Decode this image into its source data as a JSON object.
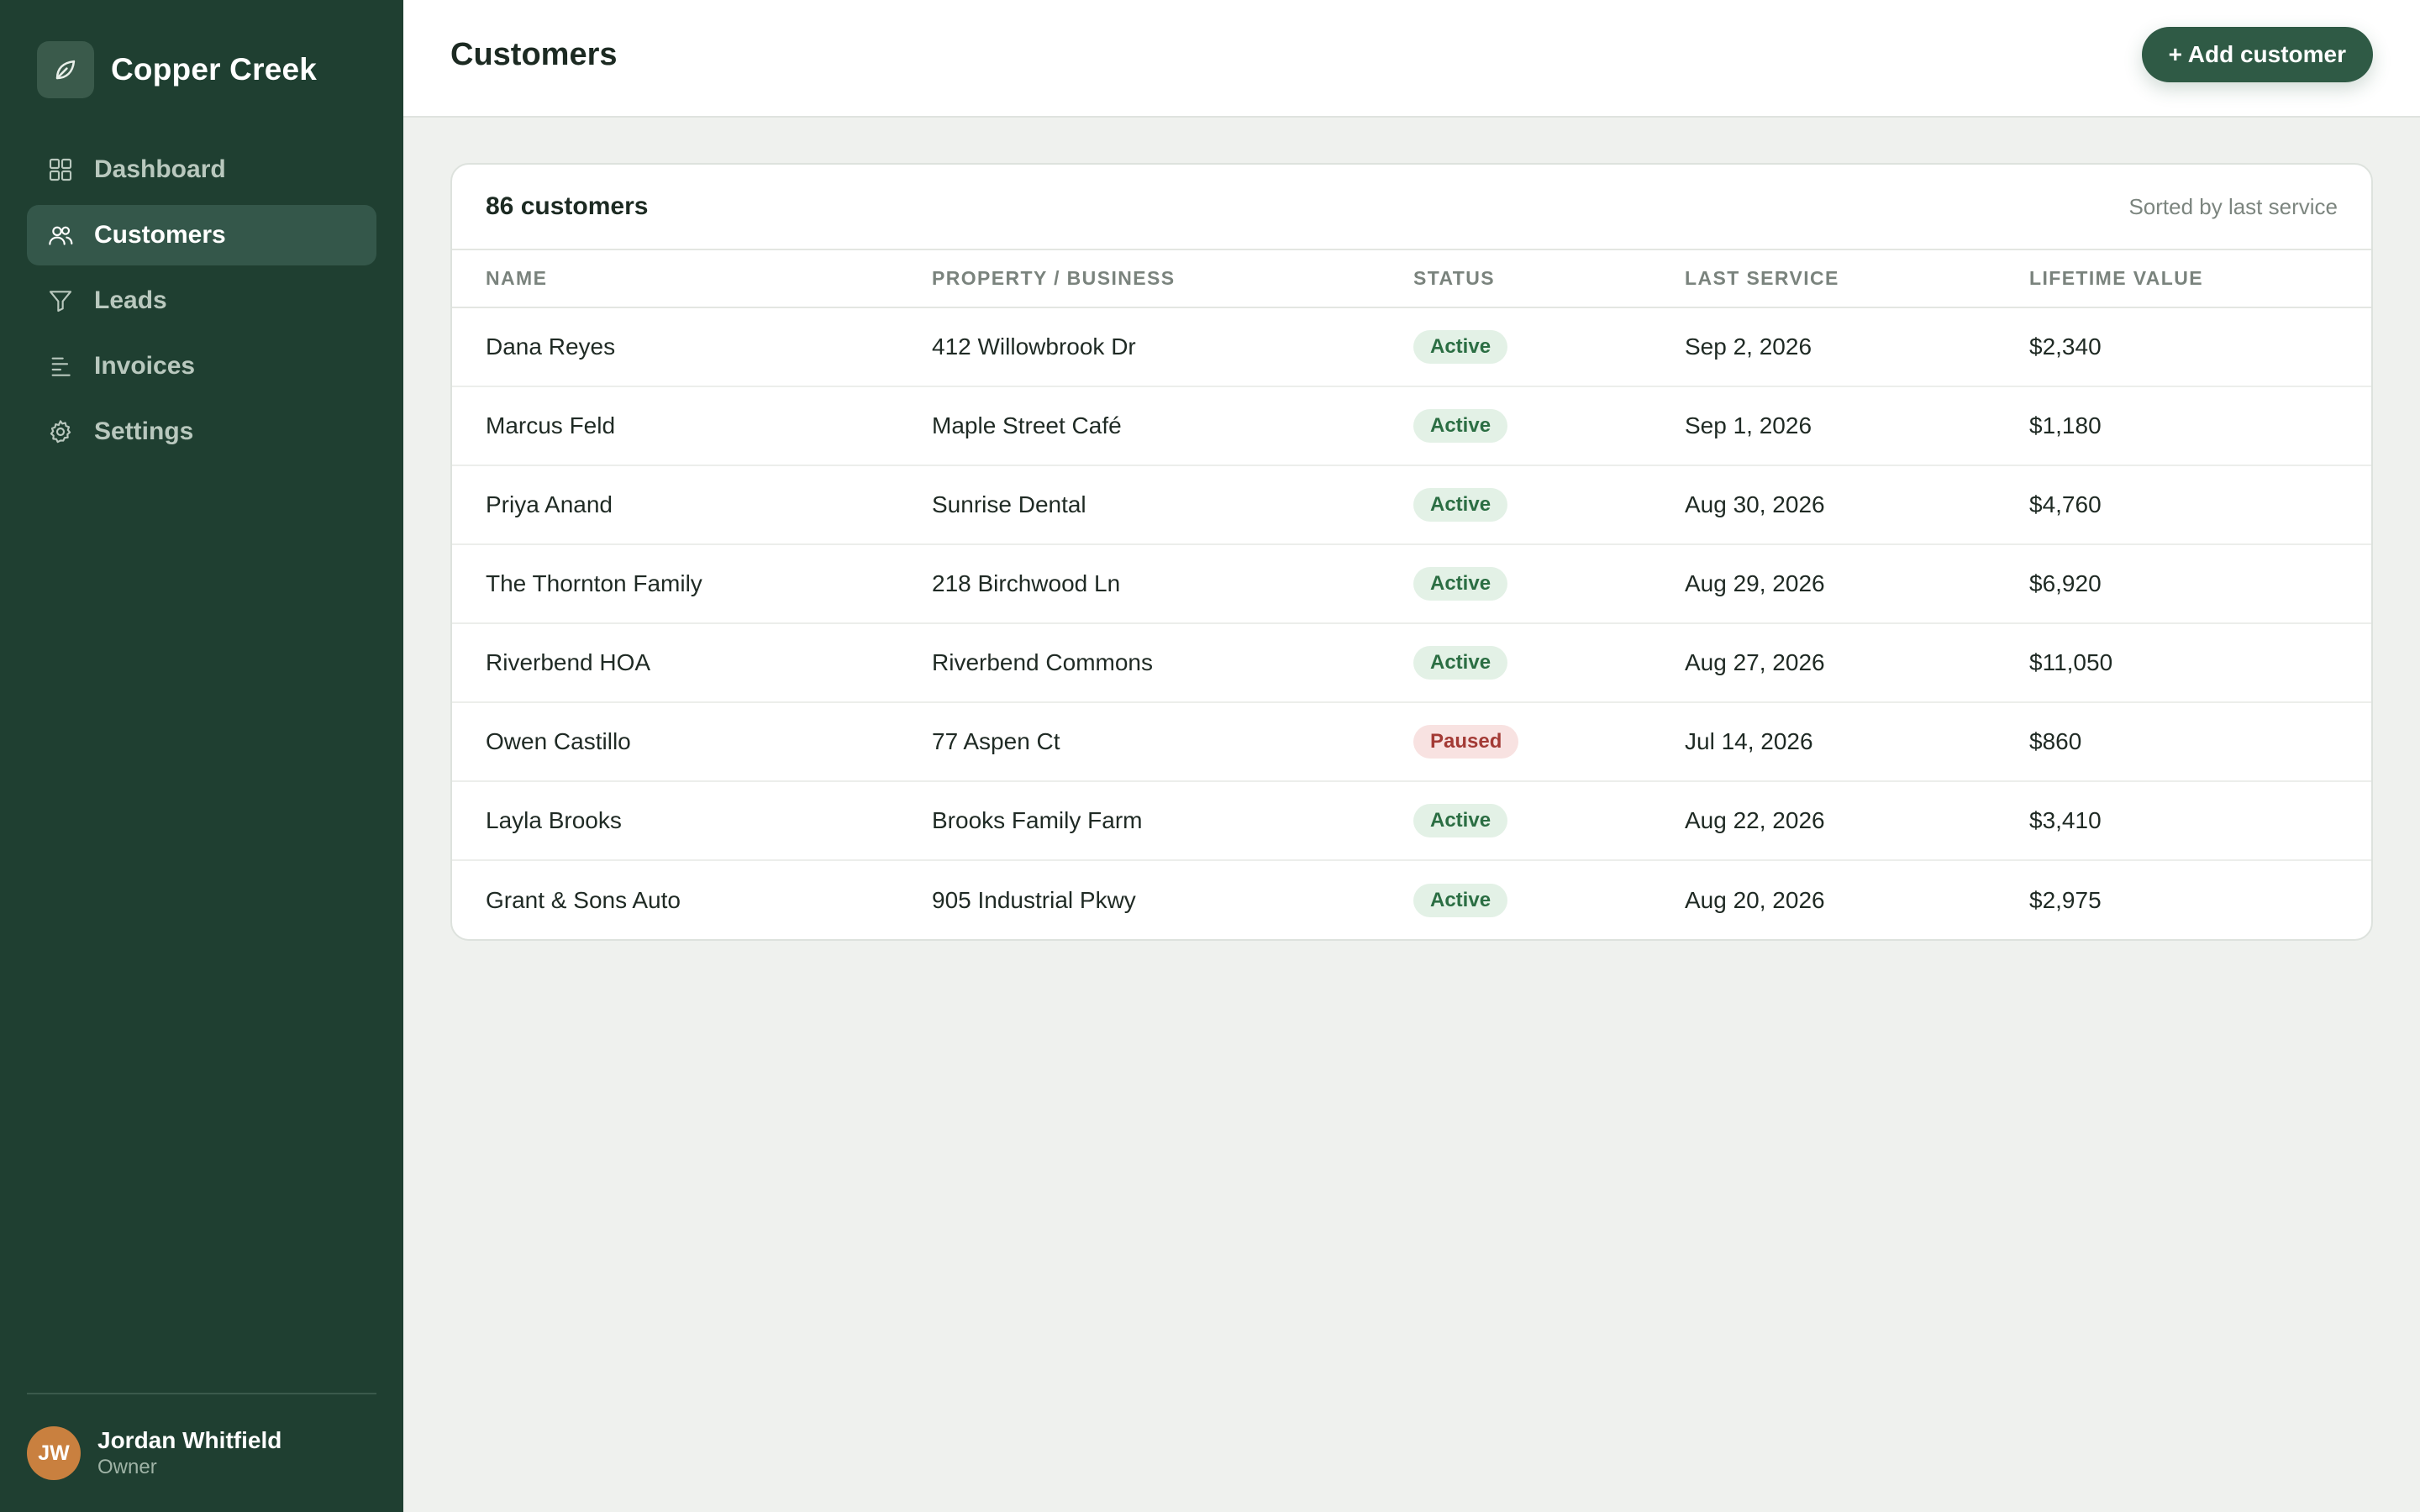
{
  "brand": {
    "name": "Copper Creek",
    "logo_icon": "leaf-icon"
  },
  "nav": {
    "items": [
      {
        "label": "Dashboard",
        "icon": "grid-icon",
        "active": false
      },
      {
        "label": "Customers",
        "icon": "users-icon",
        "active": true
      },
      {
        "label": "Leads",
        "icon": "funnel-icon",
        "active": false
      },
      {
        "label": "Invoices",
        "icon": "lines-icon",
        "active": false
      },
      {
        "label": "Settings",
        "icon": "gear-icon",
        "active": false
      }
    ]
  },
  "user": {
    "initials": "JW",
    "name": "Jordan Whitfield",
    "role": "Owner"
  },
  "header": {
    "title": "Customers",
    "add_button": "+ Add customer"
  },
  "table": {
    "count_label": "86 customers",
    "sort_label": "Sorted by last service",
    "columns": [
      "NAME",
      "PROPERTY / BUSINESS",
      "STATUS",
      "LAST SERVICE",
      "LIFETIME VALUE"
    ],
    "rows": [
      {
        "name": "Dana Reyes",
        "property": "412 Willowbrook Dr",
        "status": "Active",
        "last_service": "Sep 2, 2026",
        "value": "$2,340"
      },
      {
        "name": "Marcus Feld",
        "property": "Maple Street Café",
        "status": "Active",
        "last_service": "Sep 1, 2026",
        "value": "$1,180"
      },
      {
        "name": "Priya Anand",
        "property": "Sunrise Dental",
        "status": "Active",
        "last_service": "Aug 30, 2026",
        "value": "$4,760"
      },
      {
        "name": "The Thornton Family",
        "property": "218 Birchwood Ln",
        "status": "Active",
        "last_service": "Aug 29, 2026",
        "value": "$6,920"
      },
      {
        "name": "Riverbend HOA",
        "property": "Riverbend Commons",
        "status": "Active",
        "last_service": "Aug 27, 2026",
        "value": "$11,050"
      },
      {
        "name": "Owen Castillo",
        "property": "77 Aspen Ct",
        "status": "Paused",
        "last_service": "Jul 14, 2026",
        "value": "$860"
      },
      {
        "name": "Layla Brooks",
        "property": "Brooks Family Farm",
        "status": "Active",
        "last_service": "Aug 22, 2026",
        "value": "$3,410"
      },
      {
        "name": "Grant & Sons Auto",
        "property": "905 Industrial Pkwy",
        "status": "Active",
        "last_service": "Aug 20, 2026",
        "value": "$2,975"
      }
    ]
  },
  "colors": {
    "sidebar_bg": "#1f3f31",
    "accent": "#2f5a45",
    "active_badge": "#2b6e43",
    "paused_badge": "#a33a35",
    "avatar": "#c9803f"
  }
}
